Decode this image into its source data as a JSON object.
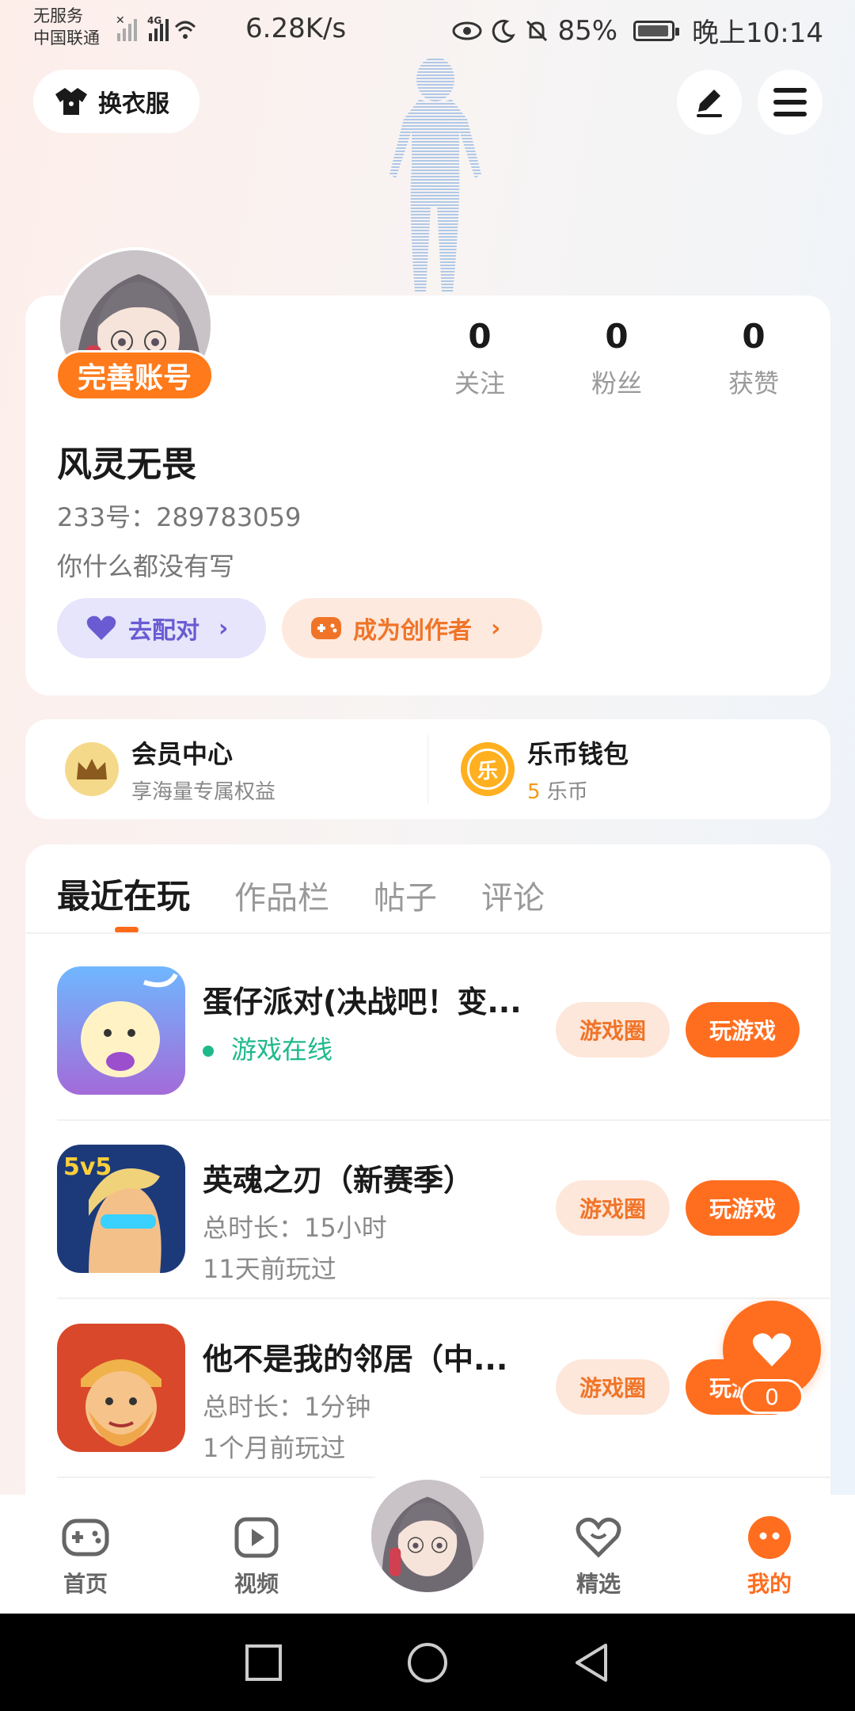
{
  "status_bar": {
    "carrier_line1": "无服务",
    "carrier_line2": "中国联通",
    "network": "4G",
    "speed": "6.28K/s",
    "battery": "85%",
    "time": "晚上10:14"
  },
  "header": {
    "dress_label": "换衣服"
  },
  "profile": {
    "complete_label": "完善账号",
    "nickname": "风灵无畏",
    "uid": "233号：289783059",
    "bio": "你什么都没有写",
    "stats": [
      {
        "value": "0",
        "label": "关注"
      },
      {
        "value": "0",
        "label": "粉丝"
      },
      {
        "value": "0",
        "label": "获赞"
      }
    ],
    "match_label": "去配对",
    "creator_label": "成为创作者"
  },
  "wallet": {
    "vip_title": "会员中心",
    "vip_sub": "享海量专属权益",
    "coin_icon_text": "乐",
    "coin_title": "乐币钱包",
    "coin_amount": "5",
    "coin_unit": " 乐币"
  },
  "tabs": [
    "最近在玩",
    "作品栏",
    "帖子",
    "评论"
  ],
  "games": [
    {
      "name": "蛋仔派对(决战吧！变...",
      "line1": "游戏在线",
      "line2": "",
      "online": true
    },
    {
      "name": "英魂之刃（新赛季）",
      "line1": "总时长：15小时",
      "line2": "11天前玩过",
      "online": false
    },
    {
      "name": "他不是我的邻居（中...",
      "line1": "总时长：1分钟",
      "line2": "1个月前玩过",
      "online": false
    }
  ],
  "game_buttons": {
    "circle": "游戏圈",
    "play": "玩游戏"
  },
  "fab": {
    "count": "0"
  },
  "bottom_nav": [
    {
      "label": "首页"
    },
    {
      "label": "视频"
    },
    {
      "label": "精选"
    },
    {
      "label": "我的"
    }
  ],
  "colors": {
    "accent": "#ff6e1f",
    "online": "#1fb98b",
    "match": "#6a5bd3"
  }
}
